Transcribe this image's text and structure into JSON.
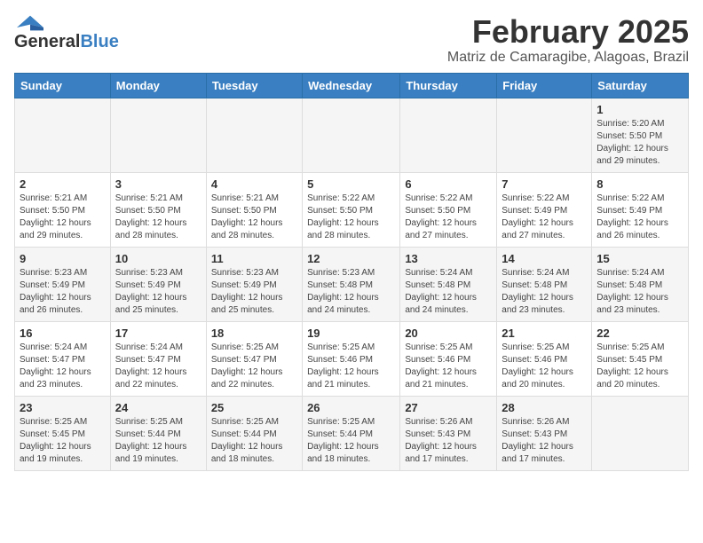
{
  "header": {
    "logo_general": "General",
    "logo_blue": "Blue",
    "month_year": "February 2025",
    "location": "Matriz de Camaragibe, Alagoas, Brazil"
  },
  "days_of_week": [
    "Sunday",
    "Monday",
    "Tuesday",
    "Wednesday",
    "Thursday",
    "Friday",
    "Saturday"
  ],
  "weeks": [
    [
      {
        "day": "",
        "info": ""
      },
      {
        "day": "",
        "info": ""
      },
      {
        "day": "",
        "info": ""
      },
      {
        "day": "",
        "info": ""
      },
      {
        "day": "",
        "info": ""
      },
      {
        "day": "",
        "info": ""
      },
      {
        "day": "1",
        "info": "Sunrise: 5:20 AM\nSunset: 5:50 PM\nDaylight: 12 hours\nand 29 minutes."
      }
    ],
    [
      {
        "day": "2",
        "info": "Sunrise: 5:21 AM\nSunset: 5:50 PM\nDaylight: 12 hours\nand 29 minutes."
      },
      {
        "day": "3",
        "info": "Sunrise: 5:21 AM\nSunset: 5:50 PM\nDaylight: 12 hours\nand 28 minutes."
      },
      {
        "day": "4",
        "info": "Sunrise: 5:21 AM\nSunset: 5:50 PM\nDaylight: 12 hours\nand 28 minutes."
      },
      {
        "day": "5",
        "info": "Sunrise: 5:22 AM\nSunset: 5:50 PM\nDaylight: 12 hours\nand 28 minutes."
      },
      {
        "day": "6",
        "info": "Sunrise: 5:22 AM\nSunset: 5:50 PM\nDaylight: 12 hours\nand 27 minutes."
      },
      {
        "day": "7",
        "info": "Sunrise: 5:22 AM\nSunset: 5:49 PM\nDaylight: 12 hours\nand 27 minutes."
      },
      {
        "day": "8",
        "info": "Sunrise: 5:22 AM\nSunset: 5:49 PM\nDaylight: 12 hours\nand 26 minutes."
      }
    ],
    [
      {
        "day": "9",
        "info": "Sunrise: 5:23 AM\nSunset: 5:49 PM\nDaylight: 12 hours\nand 26 minutes."
      },
      {
        "day": "10",
        "info": "Sunrise: 5:23 AM\nSunset: 5:49 PM\nDaylight: 12 hours\nand 25 minutes."
      },
      {
        "day": "11",
        "info": "Sunrise: 5:23 AM\nSunset: 5:49 PM\nDaylight: 12 hours\nand 25 minutes."
      },
      {
        "day": "12",
        "info": "Sunrise: 5:23 AM\nSunset: 5:48 PM\nDaylight: 12 hours\nand 24 minutes."
      },
      {
        "day": "13",
        "info": "Sunrise: 5:24 AM\nSunset: 5:48 PM\nDaylight: 12 hours\nand 24 minutes."
      },
      {
        "day": "14",
        "info": "Sunrise: 5:24 AM\nSunset: 5:48 PM\nDaylight: 12 hours\nand 23 minutes."
      },
      {
        "day": "15",
        "info": "Sunrise: 5:24 AM\nSunset: 5:48 PM\nDaylight: 12 hours\nand 23 minutes."
      }
    ],
    [
      {
        "day": "16",
        "info": "Sunrise: 5:24 AM\nSunset: 5:47 PM\nDaylight: 12 hours\nand 23 minutes."
      },
      {
        "day": "17",
        "info": "Sunrise: 5:24 AM\nSunset: 5:47 PM\nDaylight: 12 hours\nand 22 minutes."
      },
      {
        "day": "18",
        "info": "Sunrise: 5:25 AM\nSunset: 5:47 PM\nDaylight: 12 hours\nand 22 minutes."
      },
      {
        "day": "19",
        "info": "Sunrise: 5:25 AM\nSunset: 5:46 PM\nDaylight: 12 hours\nand 21 minutes."
      },
      {
        "day": "20",
        "info": "Sunrise: 5:25 AM\nSunset: 5:46 PM\nDaylight: 12 hours\nand 21 minutes."
      },
      {
        "day": "21",
        "info": "Sunrise: 5:25 AM\nSunset: 5:46 PM\nDaylight: 12 hours\nand 20 minutes."
      },
      {
        "day": "22",
        "info": "Sunrise: 5:25 AM\nSunset: 5:45 PM\nDaylight: 12 hours\nand 20 minutes."
      }
    ],
    [
      {
        "day": "23",
        "info": "Sunrise: 5:25 AM\nSunset: 5:45 PM\nDaylight: 12 hours\nand 19 minutes."
      },
      {
        "day": "24",
        "info": "Sunrise: 5:25 AM\nSunset: 5:44 PM\nDaylight: 12 hours\nand 19 minutes."
      },
      {
        "day": "25",
        "info": "Sunrise: 5:25 AM\nSunset: 5:44 PM\nDaylight: 12 hours\nand 18 minutes."
      },
      {
        "day": "26",
        "info": "Sunrise: 5:25 AM\nSunset: 5:44 PM\nDaylight: 12 hours\nand 18 minutes."
      },
      {
        "day": "27",
        "info": "Sunrise: 5:26 AM\nSunset: 5:43 PM\nDaylight: 12 hours\nand 17 minutes."
      },
      {
        "day": "28",
        "info": "Sunrise: 5:26 AM\nSunset: 5:43 PM\nDaylight: 12 hours\nand 17 minutes."
      },
      {
        "day": "",
        "info": ""
      }
    ]
  ]
}
